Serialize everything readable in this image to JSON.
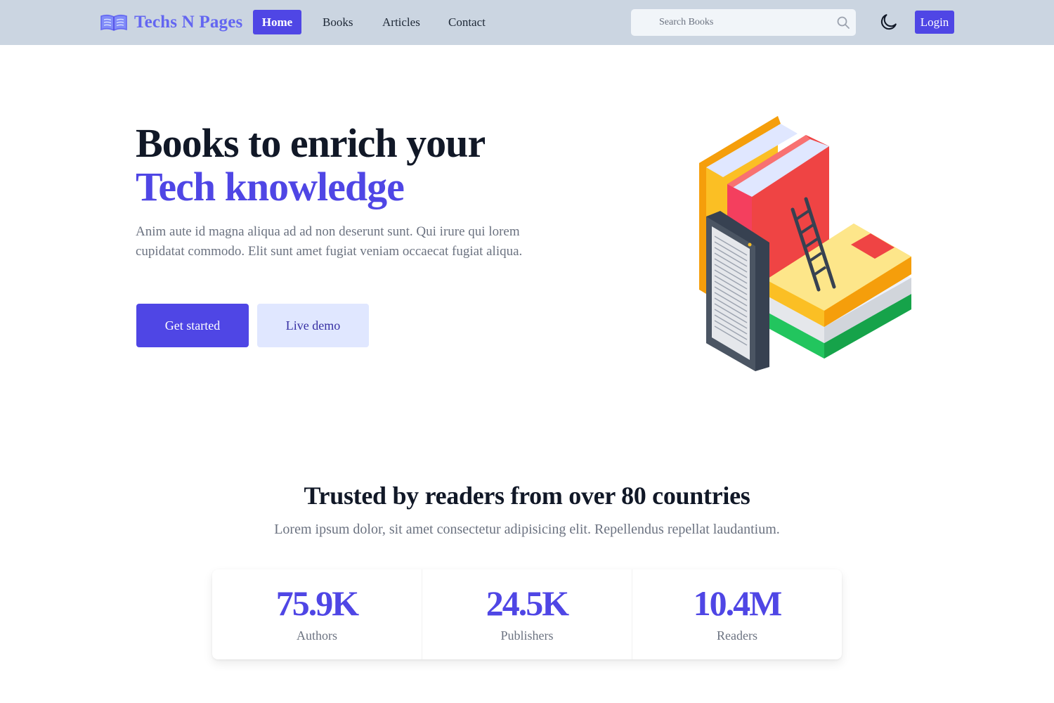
{
  "brand": {
    "name": "Techs N Pages",
    "icon": "open-book-icon"
  },
  "nav": {
    "items": [
      {
        "label": "Home",
        "active": true
      },
      {
        "label": "Books",
        "active": false
      },
      {
        "label": "Articles",
        "active": false
      },
      {
        "label": "Contact",
        "active": false
      }
    ]
  },
  "search": {
    "placeholder": "Search Books",
    "value": "",
    "icon": "search-icon"
  },
  "theme_toggle": {
    "icon": "moon-icon"
  },
  "login": {
    "label": "Login"
  },
  "hero": {
    "title_line1": "Books to enrich your",
    "title_line2": "Tech knowledge",
    "description": "Anim aute id magna aliqua ad ad non deserunt sunt. Qui irure qui lorem cupidatat commodo. Elit sunt amet fugiat veniam occaecat fugiat aliqua.",
    "primary_cta": "Get started",
    "secondary_cta": "Live demo"
  },
  "trust": {
    "title": "Trusted by readers from over 80 countries",
    "subtitle": "Lorem ipsum dolor, sit amet consectetur adipisicing elit. Repellendus repellat laudantium.",
    "stats": [
      {
        "value": "75.9K",
        "label": "Authors"
      },
      {
        "value": "24.5K",
        "label": "Publishers"
      },
      {
        "value": "10.4M",
        "label": "Readers"
      }
    ]
  },
  "colors": {
    "accent": "#4f46e5",
    "brand_text": "#6366f1",
    "navbar_bg": "#cbd5e1",
    "secondary_button_bg": "#e0e7ff"
  }
}
